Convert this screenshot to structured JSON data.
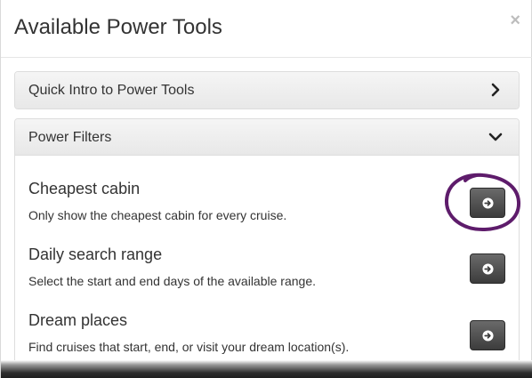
{
  "modal": {
    "title": "Available Power Tools",
    "close_label": "×"
  },
  "panels": [
    {
      "title": "Quick Intro to Power Tools",
      "icon": "chevron-right-icon",
      "expanded": false
    },
    {
      "title": "Power Filters",
      "icon": "chevron-down-icon",
      "expanded": true
    }
  ],
  "tools": [
    {
      "title": "Cheapest cabin",
      "description": "Only show the cheapest cabin for every cruise.",
      "button_icon": "arrow-circle-right-icon"
    },
    {
      "title": "Daily search range",
      "description": "Select the start and end days of the available range.",
      "button_icon": "arrow-circle-right-icon"
    },
    {
      "title": "Dream places",
      "description": "Find cruises that start, end, or visit your dream location(s).",
      "button_icon": "arrow-circle-right-icon"
    }
  ],
  "colors": {
    "annotation_circle": "#5e1c6b",
    "button_dark": "#4a4a4a"
  }
}
